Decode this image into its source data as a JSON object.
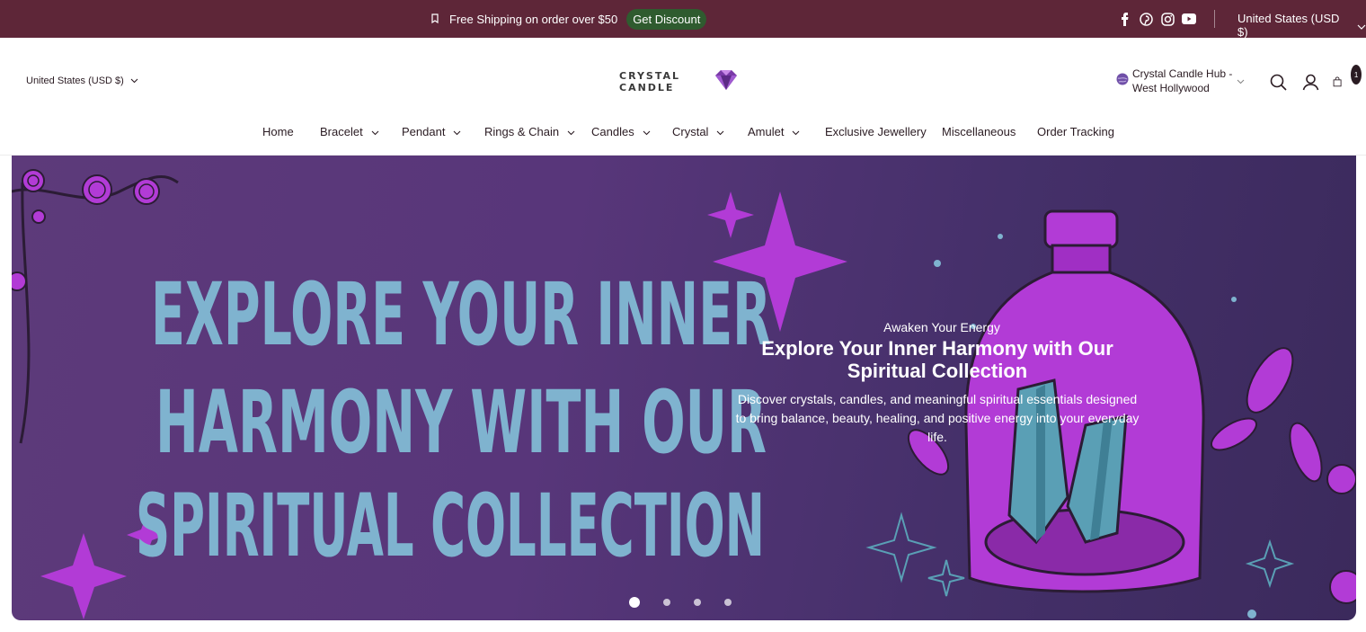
{
  "announcement": {
    "promo_text": "Free Shipping on order over $50",
    "discount_label": "Get Discount",
    "currency": "United States (USD $)",
    "socials": [
      "facebook-icon",
      "pinterest-icon",
      "instagram-icon",
      "youtube-icon"
    ]
  },
  "header": {
    "currency": "United States (USD $)",
    "logo_text": "CRYSTAL CANDLE",
    "store_name": "Crystal Candle Hub - West Hollywood",
    "cart_count": "1",
    "icons": [
      "search-icon",
      "account-icon",
      "cart-icon"
    ]
  },
  "nav": {
    "items": [
      {
        "label": "Home",
        "dropdown": false
      },
      {
        "label": "Bracelet",
        "dropdown": true
      },
      {
        "label": "Pendant",
        "dropdown": true
      },
      {
        "label": "Rings & Chain",
        "dropdown": true
      },
      {
        "label": "Candles",
        "dropdown": true
      },
      {
        "label": "Crystal",
        "dropdown": true
      },
      {
        "label": "Amulet",
        "dropdown": true
      },
      {
        "label": "Exclusive Jewellery",
        "dropdown": false
      },
      {
        "label": "Miscellaneous",
        "dropdown": false
      },
      {
        "label": "Order Tracking",
        "dropdown": false
      }
    ]
  },
  "hero": {
    "art_lines": [
      "EXPLORE YOUR INNER",
      "HARMONY WITH OUR",
      "SPIRITUAL COLLECTION"
    ],
    "eyebrow": "Awaken Your Energy",
    "headline": "Explore Your Inner Harmony with Our Spiritual Collection",
    "description": "Discover crystals, candles, and meaningful spiritual essentials designed to bring balance, beauty, healing, and positive energy into your everyday life.",
    "slide_count": 4,
    "active_slide": 1
  },
  "colors": {
    "topbar": "#5e2638",
    "discount_button": "#2f5b2f",
    "hero_text_blue": "#7fb3cf",
    "accent_purple": "#b23bd6"
  }
}
